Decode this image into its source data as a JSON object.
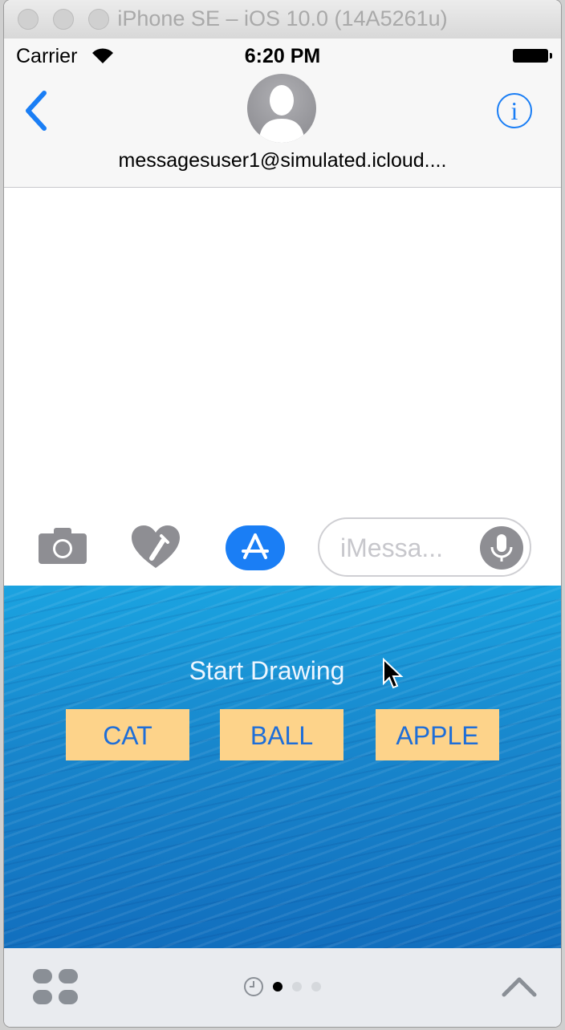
{
  "window": {
    "title": "iPhone SE – iOS 10.0 (14A5261u)"
  },
  "status_bar": {
    "carrier": "Carrier",
    "time": "6:20 PM"
  },
  "nav": {
    "contact": "messagesuser1@simulated.icloud...."
  },
  "input_bar": {
    "placeholder": "iMessa..."
  },
  "drawing": {
    "prompt": "Start Drawing",
    "words": [
      "CAT",
      "BALL",
      "APPLE"
    ]
  },
  "colors": {
    "accent": "#1a7ef5",
    "button_bg": "#fdd38a",
    "panel_blue": "#1886cc"
  },
  "icons": [
    "back-chevron-icon",
    "info-icon",
    "camera-icon",
    "digital-touch-icon",
    "app-store-icon",
    "microphone-icon",
    "app-drawer-icon",
    "recents-clock-icon",
    "expand-chevron-icon"
  ],
  "page_indicator": {
    "pages": 3,
    "current": 1
  }
}
